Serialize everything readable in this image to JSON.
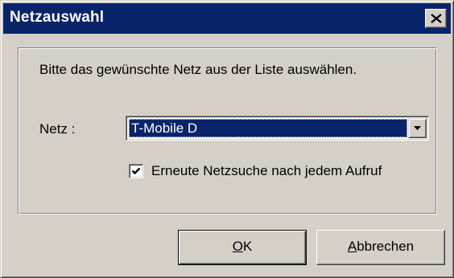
{
  "window": {
    "title": "Netzauswahl",
    "close_icon": "close-icon"
  },
  "dialog": {
    "instruction": "Bitte das gewünschte Netz aus der Liste auswählen.",
    "net_label": "Netz :",
    "net_select": {
      "selected": "T-Mobile D",
      "arrow_icon": "chevron-down-icon"
    },
    "research_checkbox": {
      "checked": true,
      "label": "Erneute Netzsuche nach jedem Aufruf"
    }
  },
  "buttons": {
    "ok": {
      "mnemonic": "O",
      "rest": "K"
    },
    "cancel": {
      "mnemonic": "A",
      "rest": "bbrechen"
    }
  },
  "colors": {
    "titlebar": "#0a246a",
    "face": "#d4d0c8",
    "selection": "#0a246a"
  }
}
